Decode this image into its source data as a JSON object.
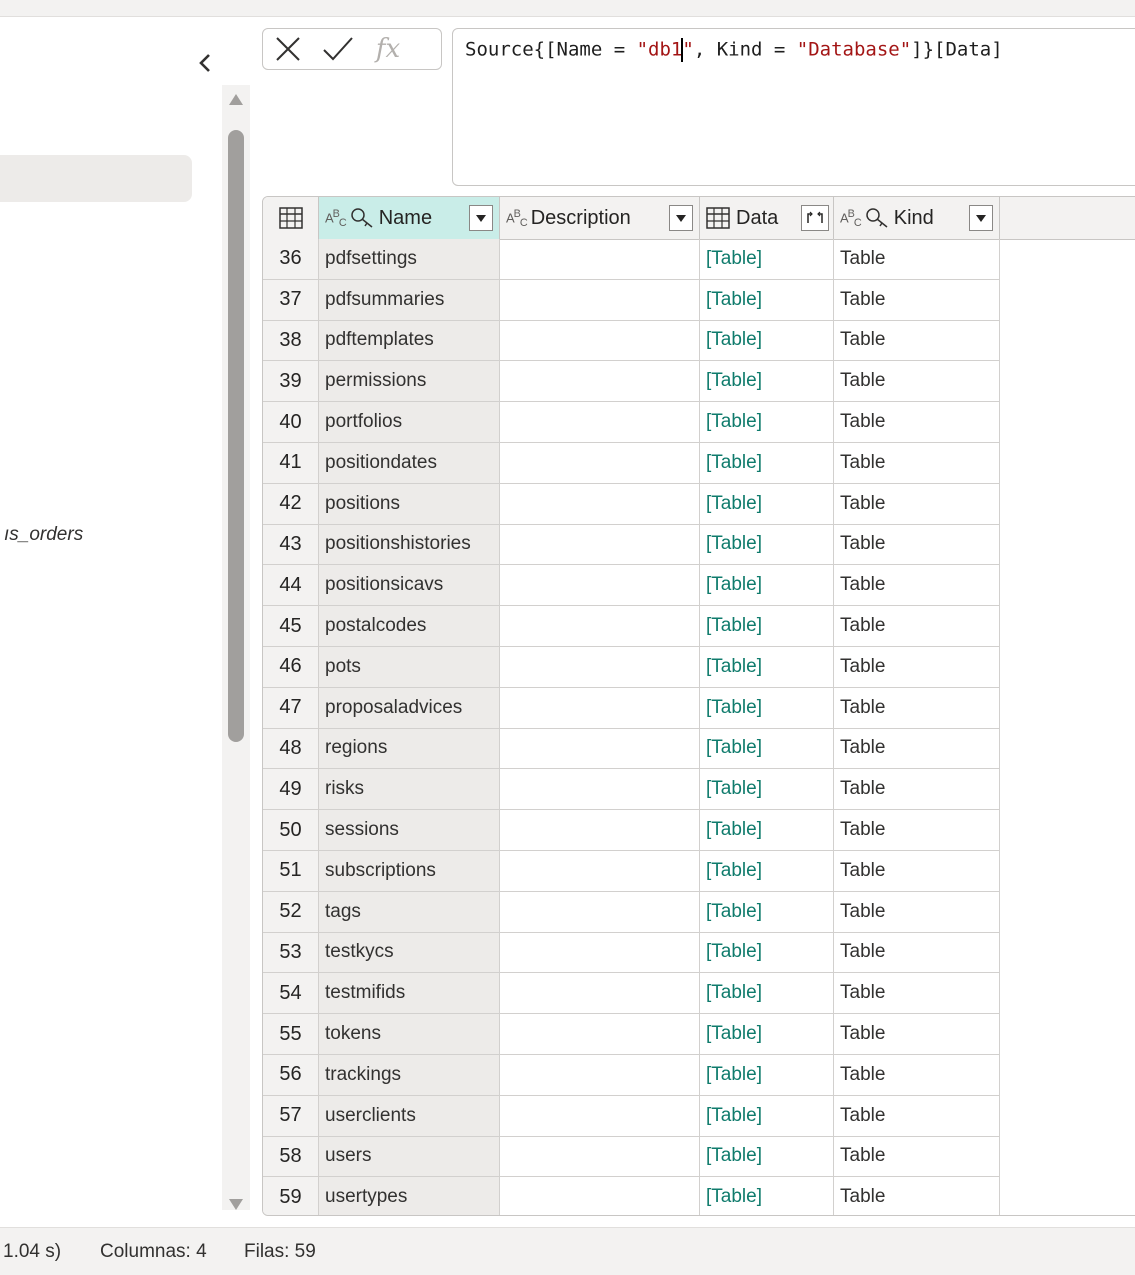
{
  "query_pane": {
    "visible_query_label": "ıs_orders"
  },
  "formula_bar": {
    "before_caret": "Source{[Name = ",
    "str1_a": "\"db1",
    "str1_b": "\"",
    "mid": ", Kind = ",
    "str2": "\"Database\"",
    "after": "]}[Data]",
    "fx_label": "fx"
  },
  "grid": {
    "columns": [
      {
        "label": "Name",
        "type": "ABC",
        "key": true
      },
      {
        "label": "Description",
        "type": "ABC",
        "key": false
      },
      {
        "label": "Data",
        "type": "table",
        "key": false
      },
      {
        "label": "Kind",
        "type": "ABC",
        "key": true
      }
    ],
    "rows": [
      {
        "idx": "36",
        "name": "pdfsettings",
        "description": "",
        "data": "[Table]",
        "kind": "Table"
      },
      {
        "idx": "37",
        "name": "pdfsummaries",
        "description": "",
        "data": "[Table]",
        "kind": "Table"
      },
      {
        "idx": "38",
        "name": "pdftemplates",
        "description": "",
        "data": "[Table]",
        "kind": "Table"
      },
      {
        "idx": "39",
        "name": "permissions",
        "description": "",
        "data": "[Table]",
        "kind": "Table"
      },
      {
        "idx": "40",
        "name": "portfolios",
        "description": "",
        "data": "[Table]",
        "kind": "Table"
      },
      {
        "idx": "41",
        "name": "positiondates",
        "description": "",
        "data": "[Table]",
        "kind": "Table"
      },
      {
        "idx": "42",
        "name": "positions",
        "description": "",
        "data": "[Table]",
        "kind": "Table"
      },
      {
        "idx": "43",
        "name": "positionshistories",
        "description": "",
        "data": "[Table]",
        "kind": "Table"
      },
      {
        "idx": "44",
        "name": "positionsicavs",
        "description": "",
        "data": "[Table]",
        "kind": "Table"
      },
      {
        "idx": "45",
        "name": "postalcodes",
        "description": "",
        "data": "[Table]",
        "kind": "Table"
      },
      {
        "idx": "46",
        "name": "pots",
        "description": "",
        "data": "[Table]",
        "kind": "Table"
      },
      {
        "idx": "47",
        "name": "proposaladvices",
        "description": "",
        "data": "[Table]",
        "kind": "Table"
      },
      {
        "idx": "48",
        "name": "regions",
        "description": "",
        "data": "[Table]",
        "kind": "Table"
      },
      {
        "idx": "49",
        "name": "risks",
        "description": "",
        "data": "[Table]",
        "kind": "Table"
      },
      {
        "idx": "50",
        "name": "sessions",
        "description": "",
        "data": "[Table]",
        "kind": "Table"
      },
      {
        "idx": "51",
        "name": "subscriptions",
        "description": "",
        "data": "[Table]",
        "kind": "Table"
      },
      {
        "idx": "52",
        "name": "tags",
        "description": "",
        "data": "[Table]",
        "kind": "Table"
      },
      {
        "idx": "53",
        "name": "testkycs",
        "description": "",
        "data": "[Table]",
        "kind": "Table"
      },
      {
        "idx": "54",
        "name": "testmifids",
        "description": "",
        "data": "[Table]",
        "kind": "Table"
      },
      {
        "idx": "55",
        "name": "tokens",
        "description": "",
        "data": "[Table]",
        "kind": "Table"
      },
      {
        "idx": "56",
        "name": "trackings",
        "description": "",
        "data": "[Table]",
        "kind": "Table"
      },
      {
        "idx": "57",
        "name": "userclients",
        "description": "",
        "data": "[Table]",
        "kind": "Table"
      },
      {
        "idx": "58",
        "name": "users",
        "description": "",
        "data": "[Table]",
        "kind": "Table"
      },
      {
        "idx": "59",
        "name": "usertypes",
        "description": "",
        "data": "[Table]",
        "kind": "Table"
      }
    ]
  },
  "status": {
    "time": "1.04 s)",
    "columns": "Columnas: 4",
    "rows": "Filas: 59"
  },
  "colors": {
    "selected_column_header": "#c9ede8",
    "table_link": "#0f7b6c",
    "formula_string": "#a31515"
  },
  "icons": {
    "collapse": "chevron-left-icon",
    "cancel": "close-icon",
    "commit": "checkmark-icon",
    "table": "table-grid-icon",
    "key": "key-icon",
    "filter": "dropdown-arrow-icon",
    "expand": "expand-columns-icon"
  }
}
